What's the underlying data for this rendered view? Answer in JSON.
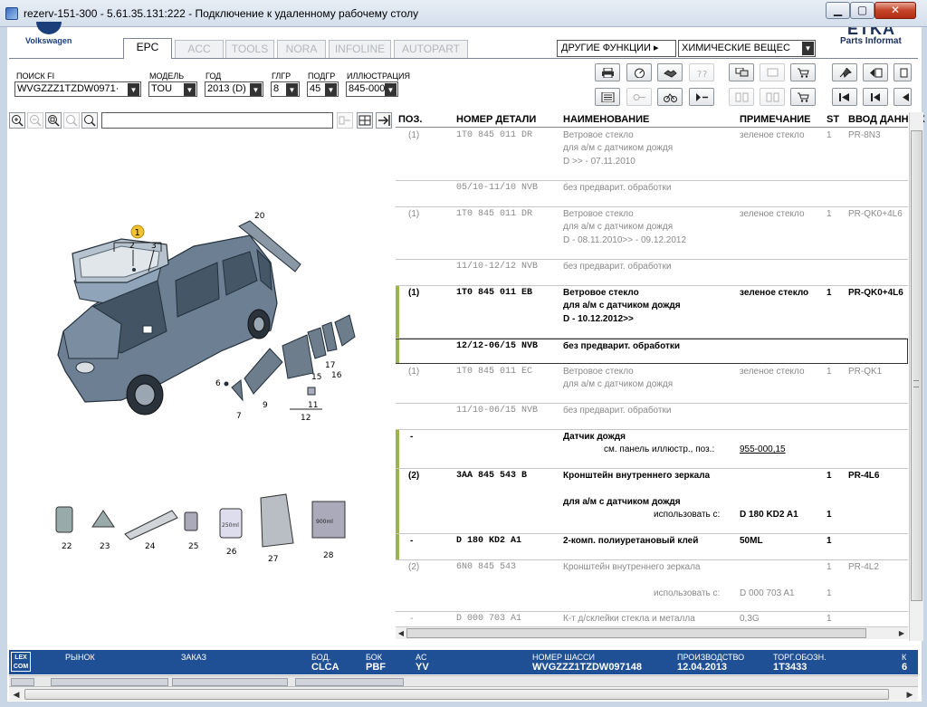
{
  "window": {
    "title": "rezerv-151-300 - 5.61.35.131:222 - Подключение к удаленному рабочему столу",
    "min_glyph": "▁",
    "max_glyph": "▢",
    "close_glyph": "✕"
  },
  "brand": {
    "vw": "Volkswagen",
    "etka_big": "ETKA",
    "etka_small": "Parts Informat"
  },
  "tabs": [
    {
      "label": "EPC",
      "active": true
    },
    {
      "label": "ACC",
      "active": false
    },
    {
      "label": "TOOLS",
      "active": false
    },
    {
      "label": "NORA",
      "active": false
    },
    {
      "label": "INFOLINE",
      "active": false
    },
    {
      "label": "AUTOPART",
      "active": false
    }
  ],
  "header": {
    "other_functions": "ДРУГИЕ ФУНКЦИИ ▸",
    "chemicals": "ХИМИЧЕСКИЕ ВЕЩЕС"
  },
  "filters": {
    "fi_label": "ПОИСК FI",
    "fi_value": "WVGZZZ1TZDW0971·",
    "model_label": "МОДЕЛЬ",
    "model_value": "TOU",
    "year_label": "ГОД",
    "year_value": "2013 (D)",
    "hg_label": "ГЛГР",
    "hg_value": "8",
    "ug_label": "ПОДГР",
    "ug_value": "45",
    "illus_label": "ИЛЛЮСТРАЦИЯ",
    "illus_value": "845-000"
  },
  "table": {
    "headers": {
      "pos": "ПОЗ.",
      "part": "НОМЕР ДЕТАЛИ",
      "name": "НАИМЕНОВАНИЕ",
      "note": "ПРИМЕЧАНИЕ",
      "st": "ST",
      "input": "ВВОД ДАННЫХ"
    },
    "rows": [
      {
        "pos": "(1)",
        "part": "1T0  845  011  DR",
        "name": [
          "Ветровое стекло",
          "для а/м с датчиком дождя",
          "D            >> - 07.11.2010"
        ],
        "note": "зеленое стекло",
        "st": "1",
        "input": "PR-8N3"
      },
      {
        "pos": "",
        "part": "05/10-11/10  NVB",
        "name": [
          "без предварит. обработки"
        ],
        "note": "",
        "st": "",
        "input": ""
      },
      {
        "pos": "(1)",
        "part": "1T0  845  011  DR",
        "name": [
          "Ветровое стекло",
          "для а/м с датчиком дождя",
          "D  - 08.11.2010>> - 09.12.2012"
        ],
        "note": "зеленое стекло",
        "st": "1",
        "input": "PR-QK0+4L6"
      },
      {
        "pos": "",
        "part": "11/10-12/12  NVB",
        "name": [
          "без предварит. обработки"
        ],
        "note": "",
        "st": "",
        "input": ""
      },
      {
        "pos": "(1)",
        "part": "1T0  845  011  EB",
        "name": [
          "Ветровое стекло",
          "для а/м с датчиком дождя",
          "D  - 10.12.2012>>"
        ],
        "note": "зеленое стекло",
        "st": "1",
        "input": "PR-QK0+4L6"
      },
      {
        "pos": "",
        "part": "12/12-06/15  NVB",
        "name": [
          "без предварит. обработки"
        ],
        "note": "",
        "st": "",
        "input": ""
      },
      {
        "pos": "(1)",
        "part": "1T0  845  011  EC",
        "name": [
          "Ветровое стекло",
          "для а/м с датчиком дождя"
        ],
        "note": "зеленое стекло",
        "st": "1",
        "input": "PR-QK1"
      },
      {
        "pos": "",
        "part": "11/10-06/15  NVB",
        "name": [
          "без предварит. обработки"
        ],
        "note": "",
        "st": "",
        "input": ""
      },
      {
        "pos": "-",
        "part": "",
        "name": [
          "Датчик дождя"
        ],
        "ref_label": "см. панель иллюстр., поз.:",
        "ref_link": "955-000,15",
        "note": "",
        "st": "",
        "input": ""
      },
      {
        "pos": "(2)",
        "part": "3AA  845  543  B",
        "name": [
          "Кронштейн внутреннего зеркала",
          "",
          "для а/м с датчиком дождя"
        ],
        "use_label": "использовать с:",
        "use_value": "D  180 KD2 A1",
        "use_st": "1",
        "note": "",
        "st": "1",
        "input": "PR-4L6"
      },
      {
        "pos": "-",
        "part": "D    180  KD2  A1",
        "name": [
          "2-комп. полиуретановый клей"
        ],
        "note": "50ML",
        "st": "1",
        "input": ""
      },
      {
        "pos": "(2)",
        "part": "6N0  845  543",
        "name": [
          "Кронштейн внутреннего зеркала"
        ],
        "use_label": "использовать с:",
        "use_value": "D  000 703 A1",
        "use_st": "1",
        "note": "",
        "st": "1",
        "input": "PR-4L2"
      },
      {
        "pos": "-",
        "part": "D    000  703  A1",
        "name": [
          "К-т д/склейки стекла и металла"
        ],
        "note": "0,3G",
        "st": "1",
        "input": ""
      }
    ]
  },
  "status": {
    "lex": "LEX COM",
    "market_label": "РЫНОК",
    "order_label": "ЗАКАЗ",
    "bod_label": "БОД.",
    "bod_value": "CLCA",
    "bok_label": "БОК",
    "bok_value": "PBF",
    "ac_label": "AC",
    "ac_value": "YV",
    "chassis_label": "НОМЕР ШАССИ",
    "chassis_value": "WVGZZZ1TZDW097148",
    "prod_label": "ПРОИЗВОДСТВО",
    "prod_value": "12.04.2013",
    "torg_label": "ТОРГ.ОБОЗН.",
    "torg_value": "1T3433",
    "k_label": "К",
    "k_value": "6"
  },
  "illustration": {
    "callouts": [
      "1",
      "2",
      "3",
      "20",
      "6",
      "7",
      "9",
      "11",
      "12",
      "15",
      "16",
      "17",
      "22",
      "23",
      "24",
      "25",
      "26",
      "27",
      "28"
    ],
    "label_26": "250ml",
    "label_28": "900ml"
  },
  "colors": {
    "accent_bar": "#9bb44b",
    "status_bg": "#1f4f95",
    "callout_yellow": "#f2c230"
  }
}
